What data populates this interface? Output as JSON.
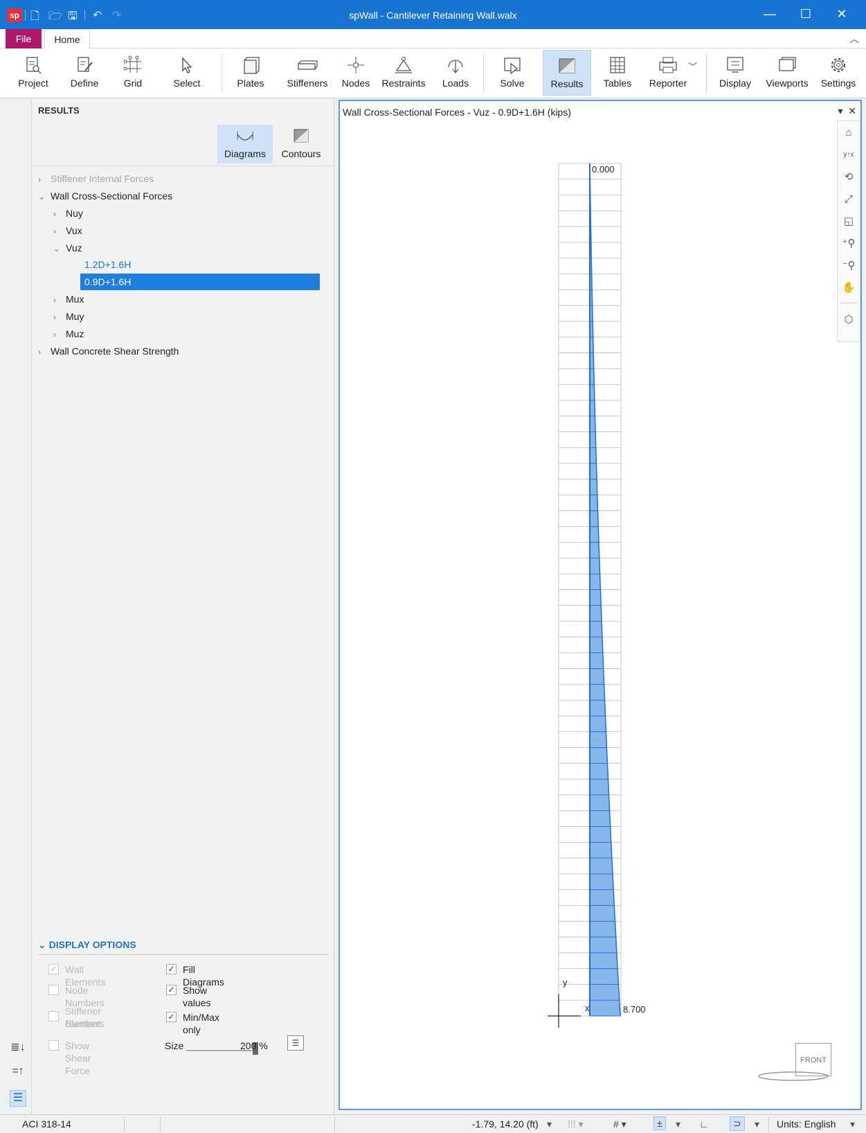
{
  "app": {
    "title": "spWall - Cantilever Retaining Wall.walx",
    "logo": "sp"
  },
  "tabs": {
    "file": "File",
    "home": "Home"
  },
  "ribbon": {
    "buttons": [
      {
        "label": "Project",
        "icon": "project-icon"
      },
      {
        "label": "Define",
        "icon": "define-icon"
      },
      {
        "label": "Grid",
        "icon": "grid-icon"
      },
      {
        "label": "Select",
        "icon": "cursor-icon"
      },
      {
        "label": "Plates",
        "icon": "plates-icon"
      },
      {
        "label": "Stiffeners",
        "icon": "stiffeners-icon"
      },
      {
        "label": "Nodes",
        "icon": "nodes-icon"
      },
      {
        "label": "Restraints",
        "icon": "restraints-icon"
      },
      {
        "label": "Loads",
        "icon": "loads-icon"
      },
      {
        "label": "Solve",
        "icon": "solve-icon"
      },
      {
        "label": "Results",
        "icon": "results-icon"
      },
      {
        "label": "Tables",
        "icon": "tables-icon"
      },
      {
        "label": "Reporter",
        "icon": "reporter-icon"
      },
      {
        "label": "Display",
        "icon": "display-icon"
      },
      {
        "label": "Viewports",
        "icon": "viewports-icon"
      },
      {
        "label": "Settings",
        "icon": "gear-icon"
      }
    ]
  },
  "results": {
    "header": "RESULTS",
    "toolbar": {
      "diagrams": "Diagrams",
      "contours": "Contours"
    },
    "tree": {
      "stiffener_internal_forces": "Stiffener Internal Forces",
      "wall_cross_sectional_forces": "Wall Cross-Sectional Forces",
      "nuy": "Nuy",
      "vux": "Vux",
      "vuz": "Vuz",
      "combo1": "1.2D+1.6H",
      "combo2": "0.9D+1.6H",
      "mux": "Mux",
      "muy": "Muy",
      "muz": "Muz",
      "wall_concrete_shear_strength": "Wall Concrete Shear Strength"
    },
    "display_options": {
      "header": "DISPLAY OPTIONS",
      "wall_elements": "Wall Elements",
      "node_numbers": "Node Numbers",
      "stiffener_element_numbers_1": "Stiffener Element",
      "stiffener_element_numbers_2": "Numbers",
      "show_shear_force": "Show Shear Force",
      "fill_diagrams": "Fill Diagrams",
      "show_values": "Show values",
      "min_max_only": "Min/Max only",
      "size_label": "Size",
      "size_value": "200 %",
      "size_percent": 200
    }
  },
  "view": {
    "title": "Wall Cross-Sectional Forces - Vuz - 0.9D+1.6H (kips)",
    "top_value": "0.000",
    "bottom_value": "8.700",
    "axis_y": "y",
    "axis_x": "x",
    "front_label": "FRONT"
  },
  "status": {
    "code": "ACI 318-14",
    "coords": "-1.79, 14.20 (ft)",
    "units": "Units:  English"
  },
  "colors": {
    "accent": "#1874d2",
    "file_tab": "#b0176a",
    "selection": "#1e7fe0",
    "diagram_fill": "#86b6ea",
    "diagram_line": "#1f6fd4"
  }
}
